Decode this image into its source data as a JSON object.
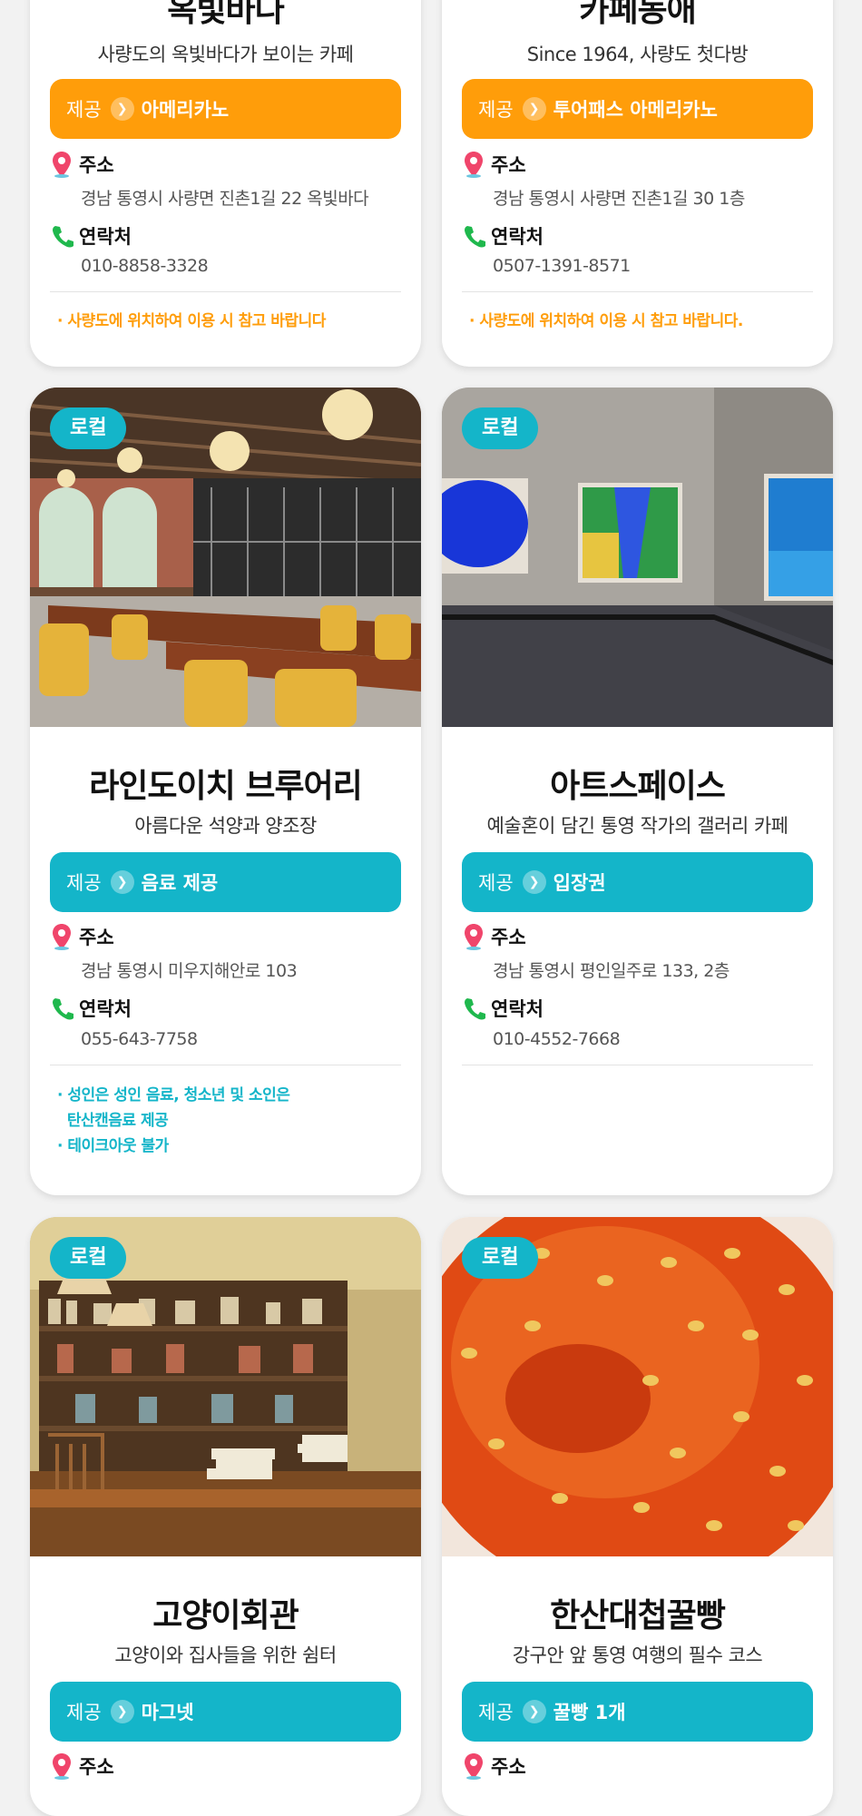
{
  "cards": [
    {
      "title": "옥빛바다",
      "subtitle": "사량도의 옥빛바다가 보이는 카페",
      "offer_label": "제공",
      "offer_value": "아메리카노",
      "address_label": "주소",
      "address": "경남 통영시 사량면 진촌1길 22 옥빛바다",
      "contact_label": "연락처",
      "contact": "010-8858-3328",
      "notes": [
        "· 사량도에 위치하여 이용 시 참고 바랍니다"
      ],
      "accent": "#ff9d0a"
    },
    {
      "title": "카페동애",
      "subtitle": "Since 1964, 사량도 첫다방",
      "offer_label": "제공",
      "offer_value": "투어패스 아메리카노",
      "address_label": "주소",
      "address": "경남 통영시 사량면 진촌1길 30 1층",
      "contact_label": "연락처",
      "contact": "0507-1391-8571",
      "notes": [
        "· 사량도에 위치하여 이용 시 참고 바랍니다."
      ],
      "accent": "#ff9d0a"
    },
    {
      "badge": "로컬",
      "title": "라인도이치 브루어리",
      "subtitle": "아름다운 석양과 양조장",
      "offer_label": "제공",
      "offer_value": "음료 제공",
      "address_label": "주소",
      "address": "경남 통영시 미우지해안로 103",
      "contact_label": "연락처",
      "contact": "055-643-7758",
      "notes": [
        "· 성인은 성인 음료, 청소년 및 소인은",
        "  탄산캔음료 제공",
        "· 테이크아웃 불가"
      ],
      "accent": "#14b5c9"
    },
    {
      "badge": "로컬",
      "title": "아트스페이스",
      "subtitle": "예술혼이 담긴 통영 작가의 갤러리 카페",
      "offer_label": "제공",
      "offer_value": "입장권",
      "address_label": "주소",
      "address": "경남 통영시 평인일주로 133, 2층",
      "contact_label": "연락처",
      "contact": "010-4552-7668",
      "accent": "#14b5c9"
    },
    {
      "badge": "로컬",
      "title": "고양이회관",
      "subtitle": "고양이와 집사들을 위한 쉼터",
      "offer_label": "제공",
      "offer_value": "마그넷",
      "address_label": "주소",
      "accent": "#14b5c9"
    },
    {
      "badge": "로컬",
      "title": "한산대첩꿀빵",
      "subtitle": "강구안 앞 통영 여행의 필수 코스",
      "offer_label": "제공",
      "offer_value": "꿀빵 1개",
      "address_label": "주소",
      "accent": "#14b5c9"
    }
  ],
  "icons": {
    "location": "map-pin-icon",
    "phone": "phone-icon",
    "offer_arrow": "chevron-right-icon"
  }
}
